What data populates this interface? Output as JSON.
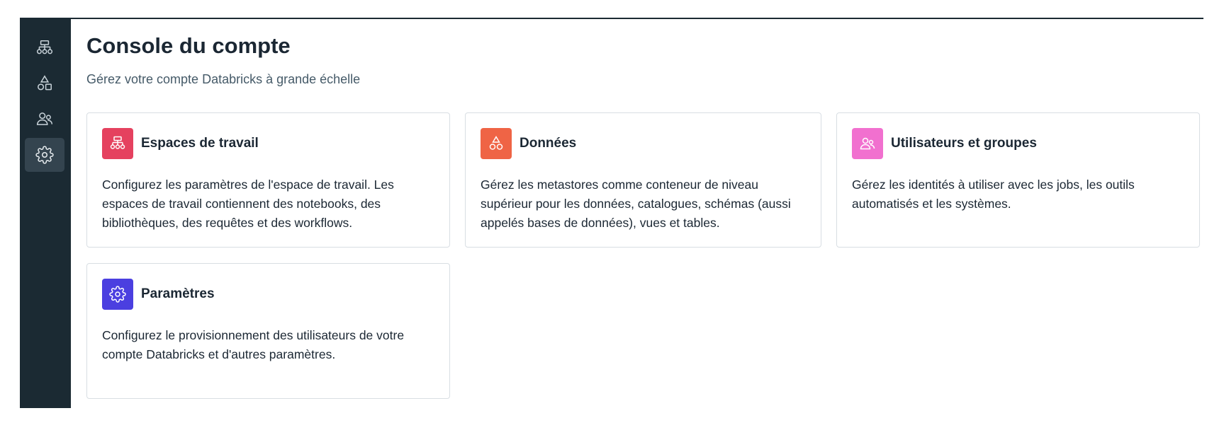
{
  "sidebar": {
    "items": [
      {
        "icon": "workspaces-icon"
      },
      {
        "icon": "data-shapes-icon"
      },
      {
        "icon": "users-icon"
      },
      {
        "icon": "gear-icon",
        "active": true
      }
    ]
  },
  "page": {
    "title": "Console du compte",
    "subtitle": "Gérez votre compte Databricks à grande échelle"
  },
  "cards": [
    {
      "title": "Espaces de travail",
      "description": "Configurez les paramètres de l'espace de travail. Les espaces de travail contiennent des notebooks, des bibliothèques, des requêtes et des workflows.",
      "icon": "workspaces-icon",
      "color": "#e5415f"
    },
    {
      "title": "Données",
      "description": "Gérez les metastores comme conteneur de niveau supérieur pour les données, catalogues, schémas (aussi appelés bases de données), vues et tables.",
      "icon": "data-shapes-icon",
      "color": "#ef6445"
    },
    {
      "title": "Utilisateurs et groupes",
      "description": "Gérez les identités à utiliser avec les jobs, les outils automatisés et les systèmes.",
      "icon": "users-icon",
      "color": "#f170cf"
    },
    {
      "title": "Paramètres",
      "description": "Configurez le provisionnement des utilisateurs de votre compte Databricks et d'autres paramètres.",
      "icon": "gear-icon",
      "color": "#4b3fe0"
    }
  ]
}
